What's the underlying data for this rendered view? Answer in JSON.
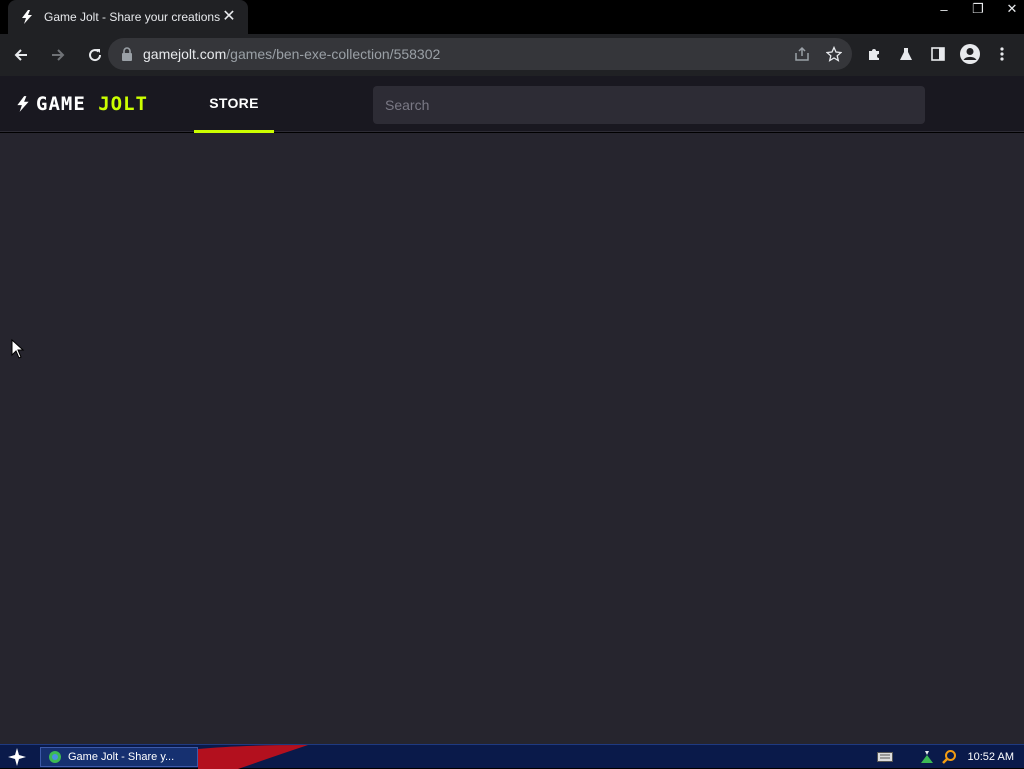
{
  "browser": {
    "tab_title": "Game Jolt - Share your creations",
    "tab_close": "✕",
    "url_host": "gamejolt.com",
    "url_path": "/games/ben-exe-collection/558302",
    "window_controls": [
      "–",
      "❐",
      "✕"
    ]
  },
  "site": {
    "logo_part1": "GAME ",
    "logo_part2": "JOLT",
    "nav_store": "STORE",
    "search_placeholder": "Search",
    "accent_color": "#ccff00",
    "background_color": "#26252e"
  },
  "taskbar": {
    "task_label": "Game Jolt - Share y...",
    "clock": "10:52 AM"
  },
  "icons": {
    "favicon": "gamejolt-bolt-icon",
    "back": "back-arrow-icon",
    "forward": "forward-arrow-icon",
    "reload": "reload-icon",
    "lock": "lock-icon",
    "share": "share-icon",
    "bookmark": "star-icon",
    "extensions": "puzzle-icon",
    "labs": "flask-icon",
    "sidepanel": "side-panel-icon",
    "profile": "profile-icon",
    "menu": "kebab-menu-icon"
  }
}
